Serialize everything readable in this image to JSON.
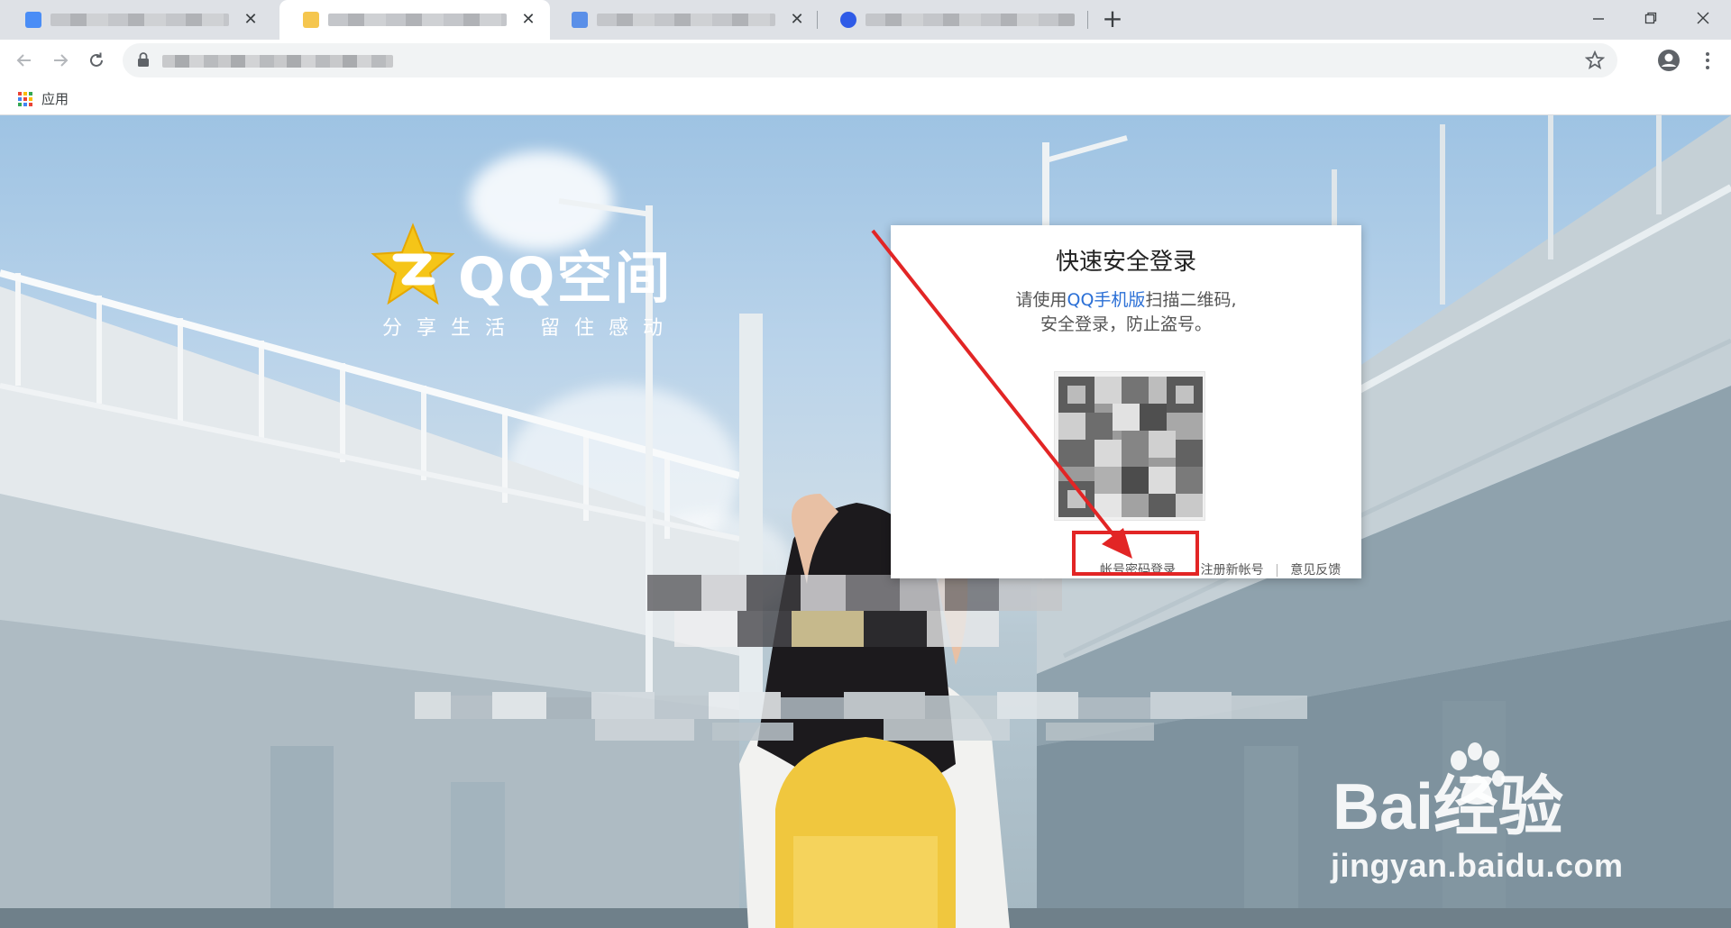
{
  "browser": {
    "tabs": [
      {
        "favicon_color": "#4a8df6",
        "active": false
      },
      {
        "favicon_color": "#f5c64e",
        "active": true
      },
      {
        "favicon_color": "#5a8fe8",
        "active": false
      },
      {
        "favicon_color": "#2f5be7",
        "active": false
      }
    ],
    "tab_close_glyph": "✕",
    "new_tab_glyph": "+",
    "bookmarks": {
      "apps_label": "应用"
    }
  },
  "page": {
    "logo": {
      "title": "QQ空间",
      "slogan": "分享生活  留住感动"
    },
    "login": {
      "title": "快速安全登录",
      "tip_prefix": "请使用",
      "tip_link": "QQ手机版",
      "tip_suffix": "扫描二维码,",
      "tip_line2": "安全登录，防止盗号。",
      "links": {
        "account_login": "帐号密码登录",
        "register": "注册新帐号",
        "feedback": "意见反馈",
        "separator": "|"
      }
    },
    "watermark": {
      "brand": "Bai经验",
      "domain": "jingyan.baidu.com"
    }
  },
  "colors": {
    "annotation": "#e22525",
    "link": "#2a6fd6"
  }
}
